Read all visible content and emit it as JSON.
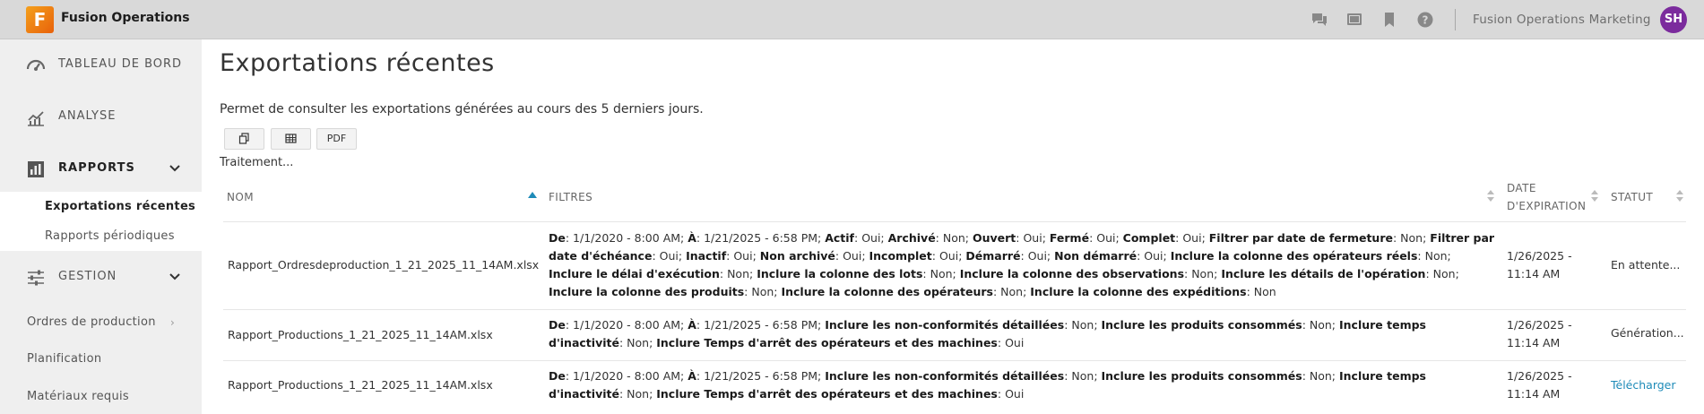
{
  "app": {
    "logo_letter": "F",
    "title": "Fusion Operations"
  },
  "topbar": {
    "icons": [
      "chat-icon",
      "screen-icon",
      "bookmark-icon",
      "help-icon"
    ],
    "org_name": "Fusion Operations Marketing",
    "avatar_initials": "SH",
    "avatar_color": "#7b2b9d"
  },
  "sidebar": {
    "dashboard": "TABLEAU DE BORD",
    "analysis": "ANALYSE",
    "reports": "RAPPORTS",
    "reports_sub": [
      "Exportations récentes",
      "Rapports périodiques"
    ],
    "management": "GESTION",
    "management_items": [
      "Ordres de production",
      "Planification",
      "Matériaux requis"
    ]
  },
  "main": {
    "title": "Exportations récentes",
    "description": "Permet de consulter les exportations générées au cours des 5 derniers jours.",
    "pdf_button": "PDF",
    "processing": "Traitement...",
    "columns": {
      "name": "NOM",
      "filters": "FILTRES",
      "expiry_1": "DATE",
      "expiry_2": "D'EXPIRATION",
      "status": "STATUT"
    },
    "rows": [
      {
        "name": "Rapport_Ordresdeproduction_1_21_2025_11_14AM.xlsx",
        "filters": [
          [
            "De",
            "1/1/2020 - 8:00 AM"
          ],
          [
            "À",
            "1/21/2025 - 6:58 PM"
          ],
          [
            "Actif",
            "Oui"
          ],
          [
            "Archivé",
            "Non"
          ],
          [
            "Ouvert",
            "Oui"
          ],
          [
            "Fermé",
            "Oui"
          ],
          [
            "Complet",
            "Oui"
          ],
          [
            "Filtrer par date de fermeture",
            "Non"
          ],
          [
            "Filtrer par date d'échéance",
            "Oui"
          ],
          [
            "Inactif",
            "Oui"
          ],
          [
            "Non archivé",
            "Oui"
          ],
          [
            "Incomplet",
            "Oui"
          ],
          [
            "Démarré",
            "Oui"
          ],
          [
            "Non démarré",
            "Oui"
          ],
          [
            "Inclure la colonne des opérateurs réels",
            "Non"
          ],
          [
            "Inclure le délai d'exécution",
            "Non"
          ],
          [
            "Inclure la colonne des lots",
            "Non"
          ],
          [
            "Inclure la colonne des observations",
            "Non"
          ],
          [
            "Inclure les détails de l'opération",
            "Non"
          ],
          [
            "Inclure la colonne des produits",
            "Non"
          ],
          [
            "Inclure la colonne des opérateurs",
            "Non"
          ],
          [
            "Inclure la colonne des expéditions",
            "Non"
          ]
        ],
        "expiry_date": "1/26/2025 -",
        "expiry_time": "11:14 AM",
        "status": "En attente...",
        "status_is_link": false
      },
      {
        "name": "Rapport_Productions_1_21_2025_11_14AM.xlsx",
        "filters": [
          [
            "De",
            "1/1/2020 - 8:00 AM"
          ],
          [
            "À",
            "1/21/2025 - 6:58 PM"
          ],
          [
            "Inclure les non-conformités détaillées",
            "Non"
          ],
          [
            "Inclure les produits consommés",
            "Non"
          ],
          [
            "Inclure temps d'inactivité",
            "Non"
          ],
          [
            "Inclure Temps d'arrêt des opérateurs et des machines",
            "Oui"
          ]
        ],
        "expiry_date": "1/26/2025 -",
        "expiry_time": "11:14 AM",
        "status": "Génération...",
        "status_is_link": false
      },
      {
        "name": "Rapport_Productions_1_21_2025_11_14AM.xlsx",
        "filters": [
          [
            "De",
            "1/1/2020 - 8:00 AM"
          ],
          [
            "À",
            "1/21/2025 - 6:58 PM"
          ],
          [
            "Inclure les non-conformités détaillées",
            "Non"
          ],
          [
            "Inclure les produits consommés",
            "Non"
          ],
          [
            "Inclure temps d'inactivité",
            "Non"
          ],
          [
            "Inclure Temps d'arrêt des opérateurs et des machines",
            "Oui"
          ]
        ],
        "expiry_date": "1/26/2025 -",
        "expiry_time": "11:14 AM",
        "status": "Télécharger",
        "status_is_link": true
      }
    ]
  },
  "colors": {
    "accent": "#1e8bb8",
    "sidebar_bg": "#efefef",
    "topbar_bg": "#d9d9d9"
  }
}
